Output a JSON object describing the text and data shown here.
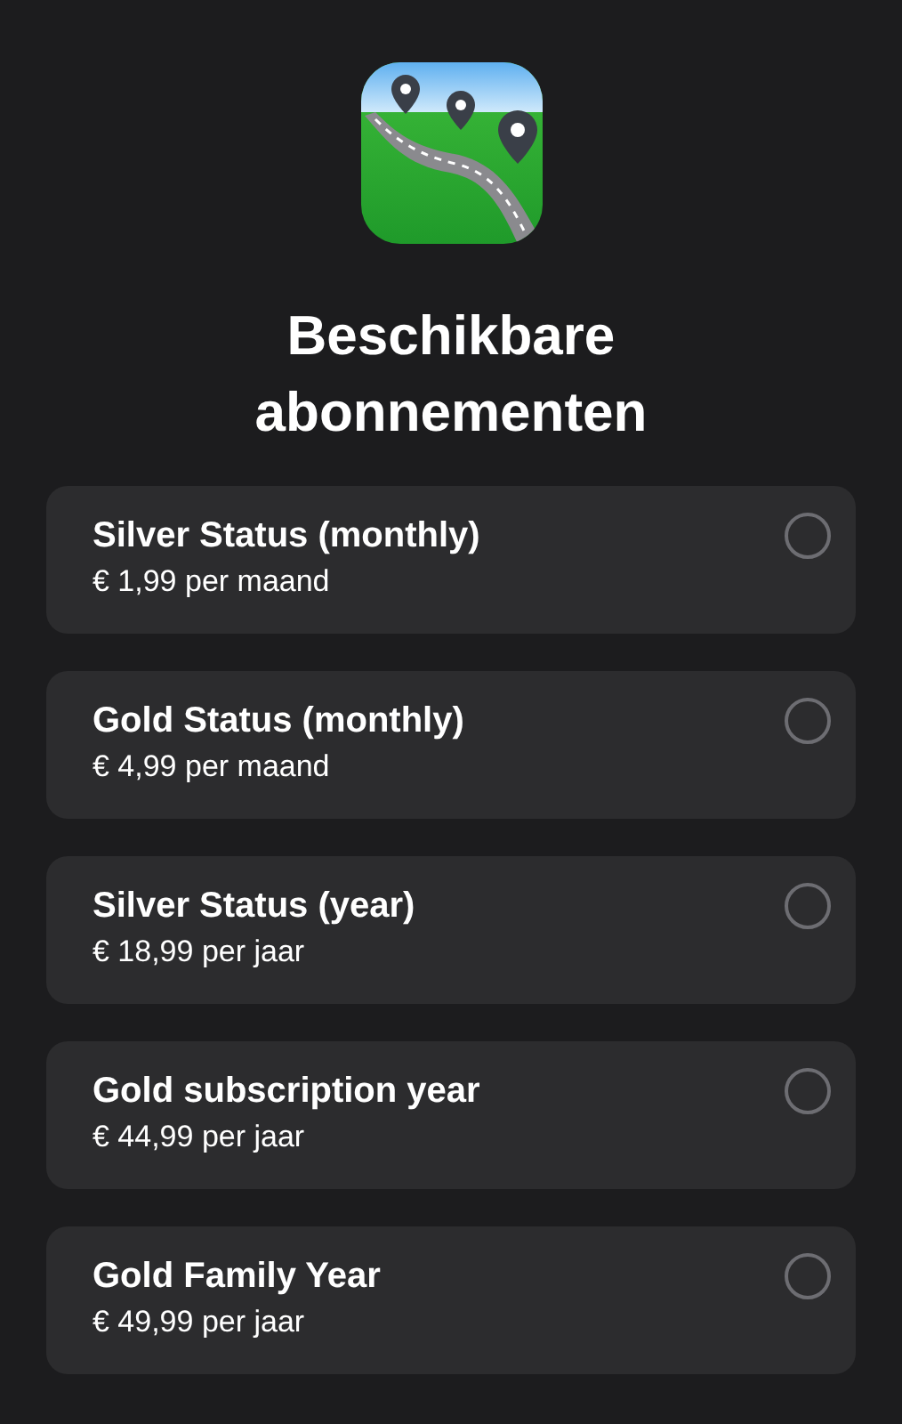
{
  "title": "Beschikbare abonnementen",
  "plans": [
    {
      "name": "Silver Status (monthly)",
      "price": "€ 1,99 per maand",
      "selected": false
    },
    {
      "name": "Gold Status (monthly)",
      "price": "€ 4,99 per maand",
      "selected": false
    },
    {
      "name": "Silver Status (year)",
      "price": "€ 18,99 per jaar",
      "selected": false
    },
    {
      "name": "Gold subscription year",
      "price": "€ 44,99 per jaar",
      "selected": false
    },
    {
      "name": "Gold Family Year",
      "price": "€ 49,99 per jaar",
      "selected": false
    }
  ]
}
